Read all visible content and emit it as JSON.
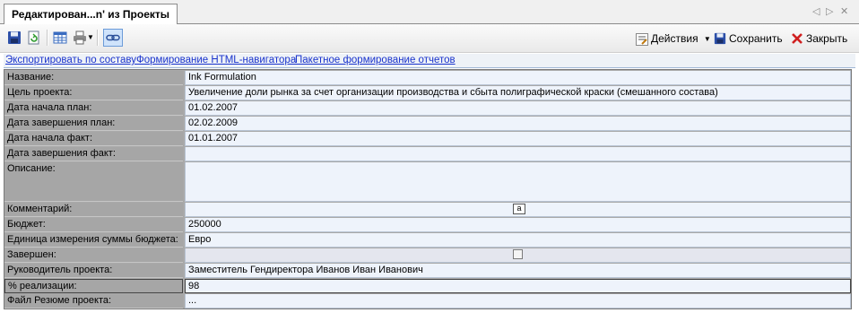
{
  "tab": {
    "title": "Редактирован...n' из Проекты"
  },
  "tab_controls": {
    "prev": "◁",
    "next": "▷",
    "close": "✕"
  },
  "toolbar": {
    "actions_label": "Действия",
    "save_label": "Сохранить",
    "close_label": "Закрыть"
  },
  "links": {
    "export": "Экспортировать по составу",
    "html_nav": "Формирование HTML-навигатора",
    "batch_reports": "Пакетное формирование отчетов"
  },
  "fields": [
    {
      "label": "Название:",
      "value": "Ink Formulation"
    },
    {
      "label": "Цель проекта:",
      "value": "Увеличение доли рынка за счет организации производства и сбыта  полиграфической краски (смешанного состава)"
    },
    {
      "label": "Дата начала план:",
      "value": "01.02.2007"
    },
    {
      "label": "Дата завершения план:",
      "value": "02.02.2009"
    },
    {
      "label": "Дата начала факт:",
      "value": "01.01.2007"
    },
    {
      "label": "Дата завершения факт:",
      "value": ""
    },
    {
      "label": "Описание:",
      "value": ""
    },
    {
      "label": "Комментарий:",
      "value": ""
    },
    {
      "label": "Бюджет:",
      "value": "250000"
    },
    {
      "label": "Единица измерения суммы бюджета:",
      "value": "Евро"
    },
    {
      "label": "Завершен:",
      "value": ""
    },
    {
      "label": "Руководитель проекта:",
      "value": "Заместитель Гендиректора Иванов Иван Иванович"
    },
    {
      "label": "% реализации:",
      "value": "98"
    },
    {
      "label": "Файл Резюме проекта:",
      "value": "..."
    }
  ],
  "memo_button": "a",
  "completed": false
}
